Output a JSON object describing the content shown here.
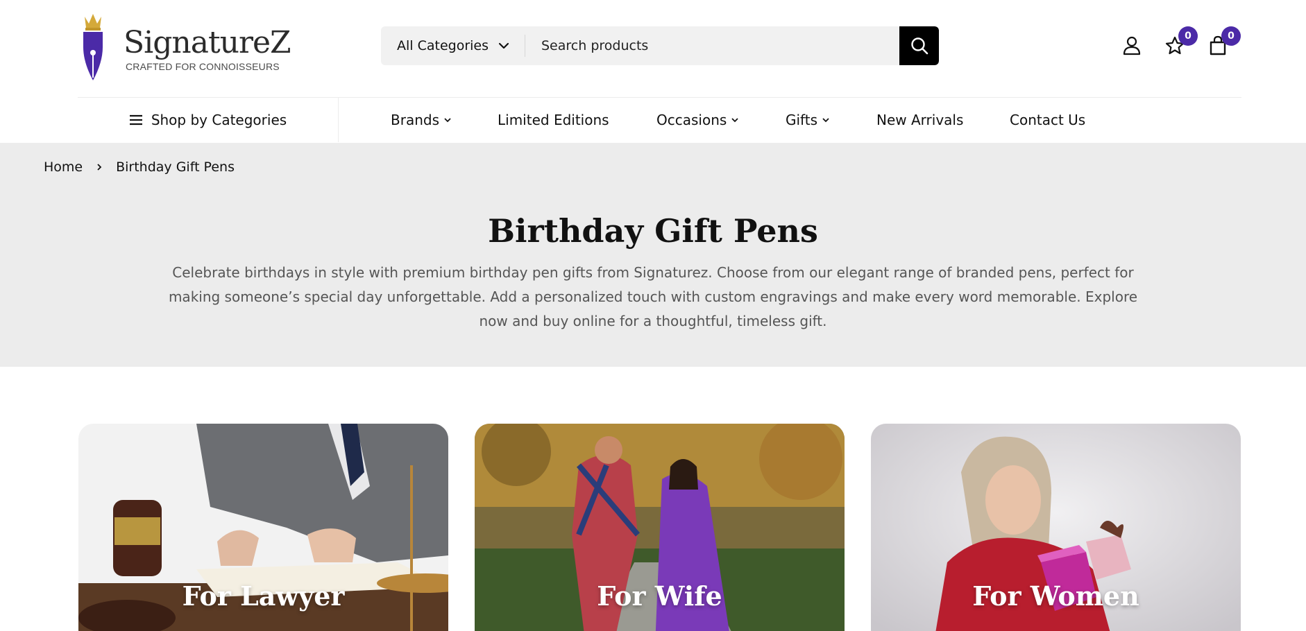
{
  "brand": {
    "name": "SignatureZ",
    "tagline": "CRAFTED FOR CONNOISSEURS",
    "accent": "#4b2aa7",
    "crown_color": "#d4a93a"
  },
  "search": {
    "category_label": "All Categories",
    "placeholder": "Search products",
    "icons": {
      "chevron": "chevron-down-icon",
      "submit": "search-icon"
    }
  },
  "header_actions": {
    "account_icon": "user-icon",
    "wishlist_icon": "star-icon",
    "wishlist_count": "0",
    "cart_icon": "shopping-bag-icon",
    "cart_count": "0"
  },
  "nav": {
    "shop_by_categories": "Shop by Categories",
    "links": [
      {
        "label": "Brands",
        "has_dropdown": true
      },
      {
        "label": "Limited Editions",
        "has_dropdown": false
      },
      {
        "label": "Occasions",
        "has_dropdown": true
      },
      {
        "label": "Gifts",
        "has_dropdown": true
      },
      {
        "label": "New Arrivals",
        "has_dropdown": false
      },
      {
        "label": "Contact Us",
        "has_dropdown": false
      }
    ]
  },
  "breadcrumb": {
    "home": "Home",
    "current": "Birthday Gift Pens"
  },
  "page": {
    "title": "Birthday Gift Pens",
    "description": "Celebrate birthdays in style with premium birthday pen gifts from Signaturez. Choose from our elegant range of branded pens, perfect for making someone’s special day unforgettable. Add a personalized touch with custom engravings and make every word memorable. Explore now and buy online for a thoughtful, timeless gift."
  },
  "cards": [
    {
      "label": "For Lawyer"
    },
    {
      "label": "For Wife"
    },
    {
      "label": "For Women"
    }
  ]
}
